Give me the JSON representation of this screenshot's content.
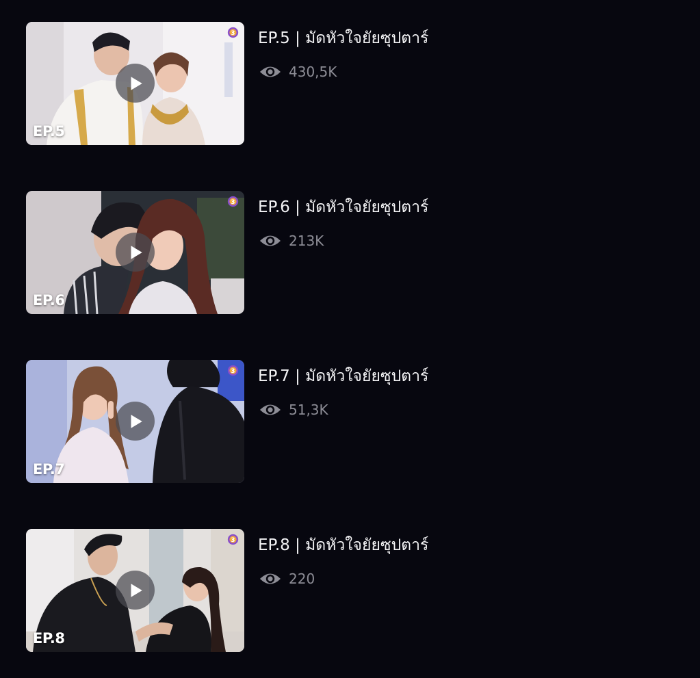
{
  "episodes": [
    {
      "badge": "EP.5",
      "title": "EP.5 | มัดหัวใจยัยซุปตาร์",
      "views": "430,5K",
      "play_icon": "play-icon",
      "view_icon": "eye-icon",
      "thumbnail_palette": [
        "#e9e6ea",
        "#c9c6cf",
        "#f3f1ef"
      ]
    },
    {
      "badge": "EP.6",
      "title": "EP.6 | มัดหัวใจยัยซุปตาร์",
      "views": "213K",
      "play_icon": "play-icon",
      "view_icon": "eye-icon",
      "thumbnail_palette": [
        "#2b2f3a",
        "#5a3a30",
        "#b9b4b8"
      ]
    },
    {
      "badge": "EP.7",
      "title": "EP.7 | มัดหัวใจยัยซุปตาร์",
      "views": "51,3K",
      "play_icon": "play-icon",
      "view_icon": "eye-icon",
      "thumbnail_palette": [
        "#c9d0ea",
        "#1a1a22",
        "#e8e0ea"
      ]
    },
    {
      "badge": "EP.8",
      "title": "EP.8 | มัดหัวใจยัยซุปตาร์",
      "views": "220",
      "play_icon": "play-icon",
      "view_icon": "eye-icon",
      "thumbnail_palette": [
        "#e6e3e2",
        "#1c1c20",
        "#cfc8c2"
      ]
    }
  ],
  "colors": {
    "background": "#07070f",
    "title_text": "#f3f3f5",
    "view_text": "#8d8d96",
    "channel_logo": "#8a4fc9"
  }
}
